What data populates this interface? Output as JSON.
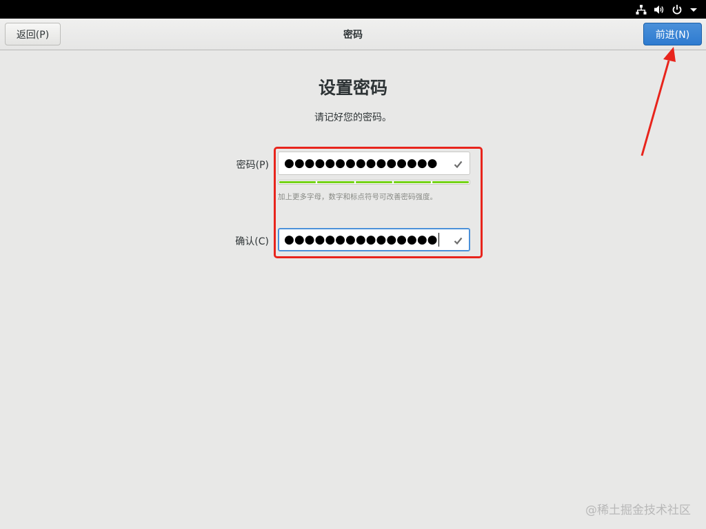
{
  "system_tray": {
    "icons": [
      "network-icon",
      "volume-icon",
      "power-icon",
      "dropdown-arrow-icon"
    ]
  },
  "header": {
    "back_label": "返回(P)",
    "title": "密码",
    "next_label": "前进(N)"
  },
  "page": {
    "title": "设置密码",
    "subtitle": "请记好您的密码。"
  },
  "form": {
    "password_label": "密码(P)",
    "password_value": "●●●●●●●●●●●●●●●",
    "strength_segments": 5,
    "strength_filled": 5,
    "strength_hint": "加上更多字母，数字和标点符号可改善密码强度。",
    "confirm_label": "确认(C)",
    "confirm_value": "●●●●●●●●●●●●●●●"
  },
  "colors": {
    "accent": "#4a90d9",
    "strength": "#73d216",
    "annotation": "#e8241c"
  },
  "watermark": "@稀土掘金技术社区"
}
